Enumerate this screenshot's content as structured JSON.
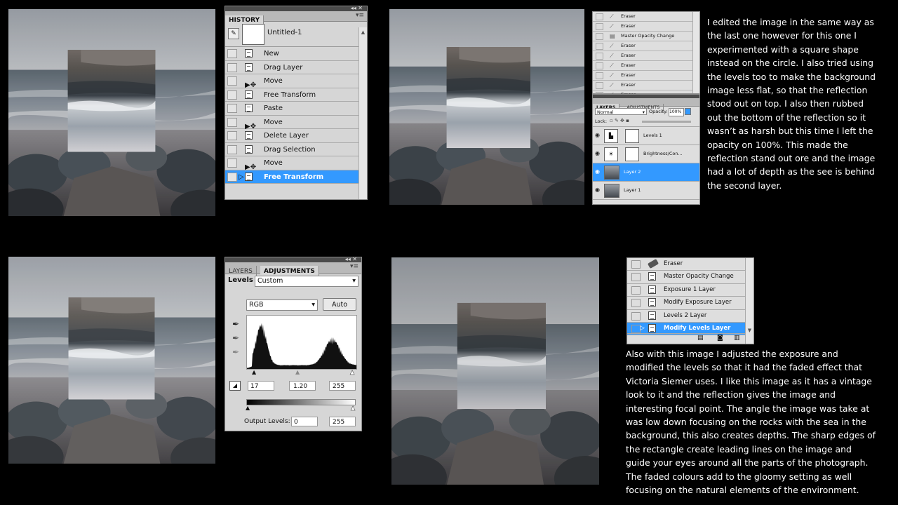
{
  "colors": {
    "page_bg": "#000000",
    "panel_bg": "#d6d6d6",
    "selection": "#3399ff",
    "text_white": "#ffffff"
  },
  "history_panel": {
    "tab": "HISTORY",
    "snapshot_label": "Untitled-1",
    "items": [
      {
        "label": "New",
        "icon": "doc-icon",
        "selected": false
      },
      {
        "label": "Drag Layer",
        "icon": "doc-icon",
        "selected": false
      },
      {
        "label": "Move",
        "icon": "move-tool-icon",
        "selected": false
      },
      {
        "label": "Free Transform",
        "icon": "doc-icon",
        "selected": false
      },
      {
        "label": "Paste",
        "icon": "doc-icon",
        "selected": false
      },
      {
        "label": "Move",
        "icon": "move-tool-icon",
        "selected": false
      },
      {
        "label": "Delete Layer",
        "icon": "doc-icon",
        "selected": false
      },
      {
        "label": "Drag Selection",
        "icon": "doc-icon",
        "selected": false
      },
      {
        "label": "Move",
        "icon": "move-tool-icon",
        "selected": false
      },
      {
        "label": "Free Transform",
        "icon": "doc-icon",
        "selected": true
      }
    ]
  },
  "history_small": {
    "items": [
      "Eraser",
      "Eraser",
      "Master Opacity Change",
      "Eraser",
      "Eraser",
      "Eraser",
      "Eraser",
      "Eraser",
      "Eraser"
    ]
  },
  "layers_panel": {
    "tabs": [
      "LAYERS",
      "ADJUSTMENTS"
    ],
    "blend_mode": "Normal",
    "opacity_label": "Opacity:",
    "opacity_value": "100%",
    "lock_label": "Lock:",
    "layers": [
      {
        "name": "Levels 1",
        "type": "adjustment",
        "selected": false
      },
      {
        "name": "Brightness/Con...",
        "type": "adjustment",
        "selected": false
      },
      {
        "name": "Layer 2",
        "type": "image",
        "selected": true
      },
      {
        "name": "Layer 1",
        "type": "image",
        "selected": false
      }
    ]
  },
  "adjustments_panel": {
    "tabs": [
      "LAYERS",
      "ADJUSTMENTS"
    ],
    "levels_label": "Levels",
    "preset_value": "Custom",
    "channel_value": "RGB",
    "auto_label": "Auto",
    "input_black": "17",
    "input_gamma": "1.20",
    "input_white": "255",
    "output_label": "Output Levels:",
    "output_black": "0",
    "output_white": "255"
  },
  "history_panel_3": {
    "items": [
      {
        "label": "Eraser",
        "icon": "eraser-icon",
        "selected": false
      },
      {
        "label": "Master Opacity Change",
        "icon": "doc-icon",
        "selected": false
      },
      {
        "label": "Exposure 1 Layer",
        "icon": "doc-icon",
        "selected": false
      },
      {
        "label": "Modify Exposure Layer",
        "icon": "doc-icon",
        "selected": false
      },
      {
        "label": "Levels 2 Layer",
        "icon": "doc-icon",
        "selected": false
      },
      {
        "label": "Modify Levels Layer",
        "icon": "doc-icon",
        "selected": true
      }
    ]
  },
  "text": {
    "paragraph_1_lines": [
      "I edited the image in the same way as",
      "the last one however for this one I",
      "experimented with a square shape",
      "instead on the circle. I also tried using",
      "the levels too to make the background",
      "image less flat, so that the reflection",
      "stood out on top. I also then rubbed",
      "out the bottom of the reflection so it",
      "wasn’t as harsh but this time I left the",
      "opacity on 100%. This made the",
      "reflection stand out ore and the image",
      "had a lot of depth as the see is behind",
      "the second layer."
    ],
    "paragraph_2_lines": [
      "Also with this image I adjusted the exposure and",
      "modified the levels so that it had the faded effect that",
      "Victoria Siemer uses. I like this image as it has a vintage",
      "look to it and the reflection gives the image and",
      "interesting focal point. The angle the image was take at",
      "was low down focusing on the rocks with the sea in the",
      "background, this also creates depths. The sharp edges of",
      "the rectangle create leading lines on the image and",
      "guide your eyes around all the parts of the photograph.",
      "The faded colours add to the gloomy setting as well",
      "focusing on the natural elements of the environment."
    ]
  }
}
